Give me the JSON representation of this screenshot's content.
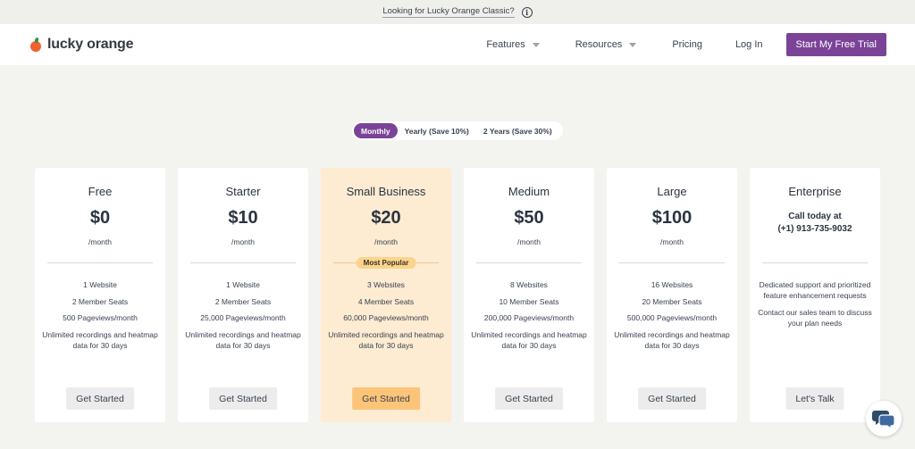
{
  "banner": {
    "text": "Looking for Lucky Orange Classic?",
    "icon": "info-icon"
  },
  "nav": {
    "logo_text": "lucky orange",
    "items": [
      {
        "label": "Features",
        "has_caret": true
      },
      {
        "label": "Resources",
        "has_caret": true
      },
      {
        "label": "Pricing",
        "has_caret": false
      },
      {
        "label": "Log In",
        "has_caret": false
      }
    ],
    "cta": "Start My Free Trial"
  },
  "billing_toggle": {
    "options": [
      "Monthly",
      "Yearly (Save 10%)",
      "2 Years (Save 30%)"
    ],
    "selected": "Monthly"
  },
  "plans": [
    {
      "name": "Free",
      "price": "$0",
      "period": "/month",
      "features": [
        "1 Website",
        "2 Member Seats",
        "500 Pageviews/month",
        "Unlimited recordings and heatmap data for 30 days"
      ],
      "button": "Get Started"
    },
    {
      "name": "Starter",
      "price": "$10",
      "period": "/month",
      "features": [
        "1 Website",
        "2 Member Seats",
        "25,000 Pageviews/month",
        "Unlimited recordings and heatmap data for 30 days"
      ],
      "button": "Get Started"
    },
    {
      "name": "Small Business",
      "price": "$20",
      "period": "/month",
      "badge": "Most Popular",
      "features": [
        "3 Websites",
        "4 Member Seats",
        "60,000 Pageviews/month",
        "Unlimited recordings and heatmap data for 30 days"
      ],
      "button": "Get Started"
    },
    {
      "name": "Medium",
      "price": "$50",
      "period": "/month",
      "features": [
        "8 Websites",
        "10 Member Seats",
        "200,000 Pageviews/month",
        "Unlimited recordings and heatmap data for 30 days"
      ],
      "button": "Get Started"
    },
    {
      "name": "Large",
      "price": "$100",
      "period": "/month",
      "features": [
        "16 Websites",
        "20 Member Seats",
        "500,000 Pageviews/month",
        "Unlimited recordings and heatmap data for 30 days"
      ],
      "button": "Get Started"
    },
    {
      "name": "Enterprise",
      "contact_line1": "Call today at",
      "contact_line2": "(+1) 913-735-9032",
      "features": [
        "Dedicated support and prioritized feature enhancement requests",
        "Contact our sales team to discuss your plan needs"
      ],
      "button": "Let's Talk"
    }
  ],
  "chat_widget": {
    "icon": "chat-bubbles-icon"
  },
  "colors": {
    "brand_purple": "#7b4397",
    "highlight_bg": "#fdebd2",
    "badge": "#fbd38d",
    "highlight_button": "#fbc478",
    "logo_orange": "#f0612d"
  }
}
